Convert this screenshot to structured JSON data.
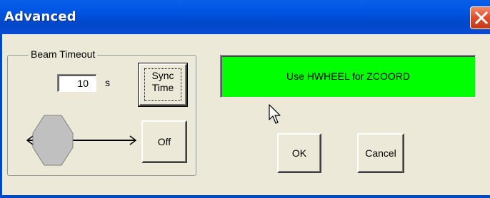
{
  "window": {
    "title": "Advanced",
    "close_label": "Close"
  },
  "beam_timeout": {
    "group_label": "Beam Timeout",
    "value": "10",
    "unit": "s",
    "sync_button_line1": "Sync",
    "sync_button_line2": "Time",
    "off_button": "Off"
  },
  "status": {
    "message": "Use HWHEEL for ZCOORD",
    "color": "#00ff00"
  },
  "actions": {
    "ok": "OK",
    "cancel": "Cancel"
  },
  "icons": {
    "close": "close-icon",
    "slider_thumb": "slider-thumb-icon",
    "left_arrow": "left-arrow-icon",
    "right_arrow": "right-arrow-icon",
    "cursor": "mouse-cursor-icon"
  }
}
